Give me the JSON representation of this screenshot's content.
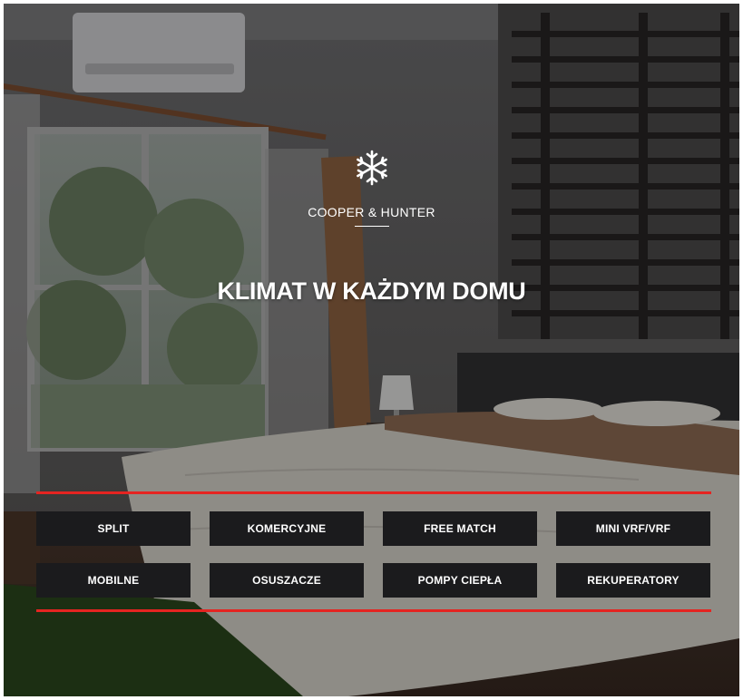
{
  "brand": {
    "icon": "snowflake-icon",
    "name": "COOPER & HUNTER"
  },
  "hero": {
    "headline": "KLIMAT W KAŻDYM DOMU"
  },
  "colors": {
    "accent": "#e52421",
    "button_bg": "#1b1b1d",
    "text": "#ffffff"
  },
  "categories": [
    {
      "label": "SPLIT"
    },
    {
      "label": "KOMERCYJNE"
    },
    {
      "label": "FREE MATCH"
    },
    {
      "label": "MINI VRF/VRF"
    },
    {
      "label": "MOBILNE"
    },
    {
      "label": "OSUSZACZE"
    },
    {
      "label": "POMPY CIEPŁA"
    },
    {
      "label": "REKUPERATORY"
    }
  ]
}
